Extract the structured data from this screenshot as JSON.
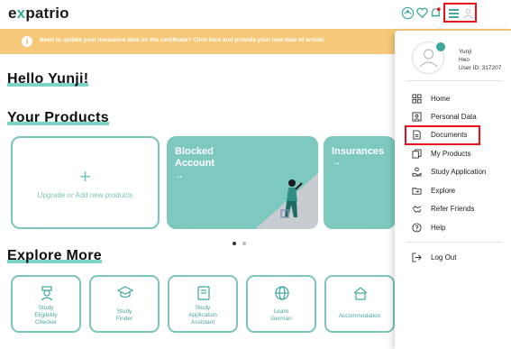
{
  "header": {
    "logo_pre": "e",
    "logo_x": "x",
    "logo_post": "patrio",
    "icons": [
      "support-icon",
      "heart-icon",
      "bell-icon",
      "hamburger-menu-icon",
      "user-avatar-icon"
    ]
  },
  "banner": {
    "message": "Need to update your insurance date on the certificate? Click here and provide your new date of arrival."
  },
  "greeting": "Hello Yunji!",
  "products": {
    "heading": "Your Products",
    "add_label": "Upgrade or Add new products",
    "add_symbol": "+",
    "cards": [
      {
        "title_line1": "Blocked",
        "title_line2": "Account",
        "arrow": "→"
      },
      {
        "title_line1": "Insurances",
        "arrow": "→"
      }
    ]
  },
  "explore": {
    "heading": "Explore More",
    "tiles": [
      {
        "line1": "Study",
        "line2": "Eligibility",
        "line3": "Checker",
        "icon": "student-icon"
      },
      {
        "line1": "Study",
        "line2": "Finder",
        "icon": "graduation-cap-icon"
      },
      {
        "line1": "Study",
        "line2": "Application",
        "line3": "Assistant",
        "icon": "application-icon"
      },
      {
        "line1": "Learn",
        "line2": "German",
        "icon": "globe-icon"
      },
      {
        "line1": "Accommodation",
        "icon": "house-icon"
      }
    ]
  },
  "menu": {
    "user_name": "Yunji",
    "user_surname": "Heo",
    "user_id": "User ID: 317207",
    "items": [
      {
        "label": "Home",
        "icon": "grid-icon"
      },
      {
        "label": "Personal Data",
        "icon": "id-card-icon"
      },
      {
        "label": "Documents",
        "icon": "document-icon"
      },
      {
        "label": "My Products",
        "icon": "copy-icon"
      },
      {
        "label": "Study Application",
        "icon": "hand-icon"
      },
      {
        "label": "Explore",
        "icon": "folder-icon"
      },
      {
        "label": "Refer Friends",
        "icon": "handshake-icon"
      },
      {
        "label": "Help",
        "icon": "help-icon"
      }
    ],
    "logout": "Log Out"
  },
  "colors": {
    "accent": "#7ec9bf",
    "accent_dark": "#3aa89a",
    "banner": "#f6c97a",
    "highlight": "#e8101c"
  }
}
